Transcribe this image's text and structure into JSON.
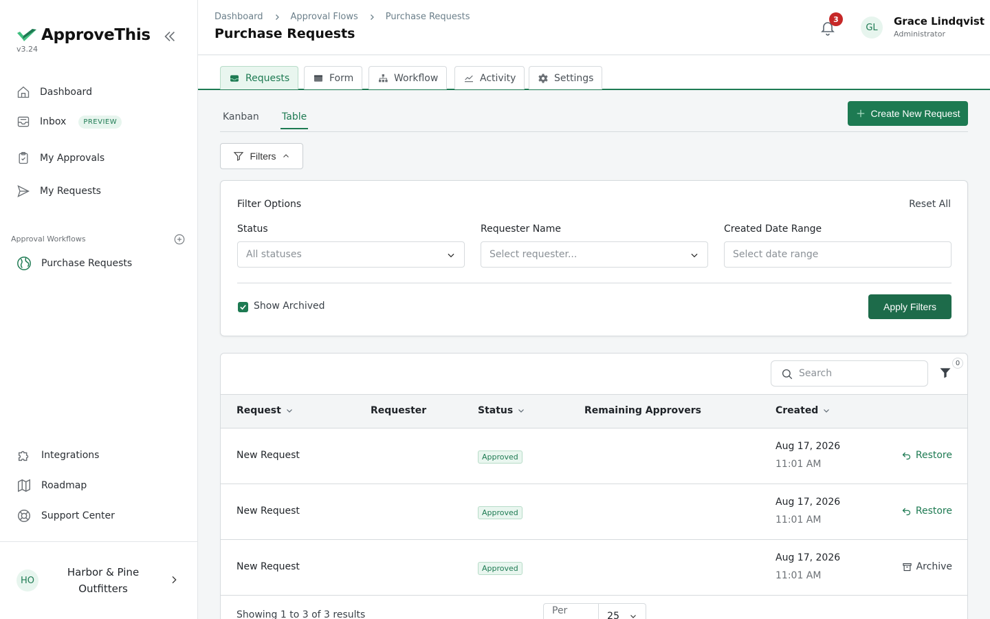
{
  "app": {
    "name": "ApproveThis",
    "version": "v3.24"
  },
  "sidebar": {
    "nav": [
      {
        "label": "Dashboard",
        "icon": "home-icon"
      },
      {
        "label": "Inbox",
        "icon": "inbox-icon",
        "badge": "PREVIEW"
      },
      {
        "label": "My Approvals",
        "icon": "clipboard-check-icon"
      },
      {
        "label": "My Requests",
        "icon": "send-icon"
      }
    ],
    "section_label": "Approval Workflows",
    "workflows": [
      {
        "label": "Purchase Requests",
        "icon": "globe-icon"
      }
    ],
    "footer_nav": [
      {
        "label": "Integrations",
        "icon": "puzzle-icon"
      },
      {
        "label": "Roadmap",
        "icon": "map-icon"
      },
      {
        "label": "Support Center",
        "icon": "lifebuoy-icon"
      }
    ],
    "org": {
      "initials": "HO",
      "name": "Harbor & Pine Outfitters"
    }
  },
  "header": {
    "breadcrumbs": [
      "Dashboard",
      "Approval Flows",
      "Purchase Requests"
    ],
    "title": "Purchase Requests",
    "notifications_count": "3",
    "user": {
      "initials": "GL",
      "name": "Grace Lindqvist",
      "role": "Administrator"
    }
  },
  "tabs": [
    {
      "label": "Requests",
      "icon": "inbox-tray-icon",
      "active": true
    },
    {
      "label": "Form",
      "icon": "form-icon",
      "active": false
    },
    {
      "label": "Workflow",
      "icon": "workflow-icon",
      "active": false
    },
    {
      "label": "Activity",
      "icon": "activity-chart-icon",
      "active": false
    },
    {
      "label": "Settings",
      "icon": "gear-icon",
      "active": false
    }
  ],
  "view_tabs": [
    {
      "label": "Kanban",
      "active": false
    },
    {
      "label": "Table",
      "active": true
    }
  ],
  "create_button": "Create New Request",
  "filters_button": "Filters",
  "filter_panel": {
    "title": "Filter Options",
    "reset": "Reset All",
    "status": {
      "label": "Status",
      "placeholder": "All statuses"
    },
    "requester": {
      "label": "Requester Name",
      "placeholder": "Select requester..."
    },
    "date": {
      "label": "Created Date Range",
      "placeholder": "Select date range"
    },
    "show_archived": {
      "label": "Show Archived",
      "checked": true
    },
    "apply": "Apply Filters"
  },
  "table": {
    "search_placeholder": "Search",
    "filter_count": "0",
    "columns": [
      "Request",
      "Requester",
      "Status",
      "Remaining Approvers",
      "Created"
    ],
    "rows": [
      {
        "request": "New Request",
        "requester": "",
        "status": "Approved",
        "remaining": "",
        "date": "Aug 17, 2026",
        "time": "11:01 AM",
        "action": "Restore"
      },
      {
        "request": "New Request",
        "requester": "",
        "status": "Approved",
        "remaining": "",
        "date": "Aug 17, 2026",
        "time": "11:01 AM",
        "action": "Restore"
      },
      {
        "request": "New Request",
        "requester": "",
        "status": "Approved",
        "remaining": "",
        "date": "Aug 17, 2026",
        "time": "11:01 AM",
        "action": "Archive"
      }
    ],
    "footer_text": "Showing 1 to 3 of 3 results",
    "per_page_label": "Per page",
    "per_page_value": "25"
  },
  "colors": {
    "accent": "#1d7a52",
    "badge": "#c62828",
    "accent_light": "#e9f6ef"
  }
}
